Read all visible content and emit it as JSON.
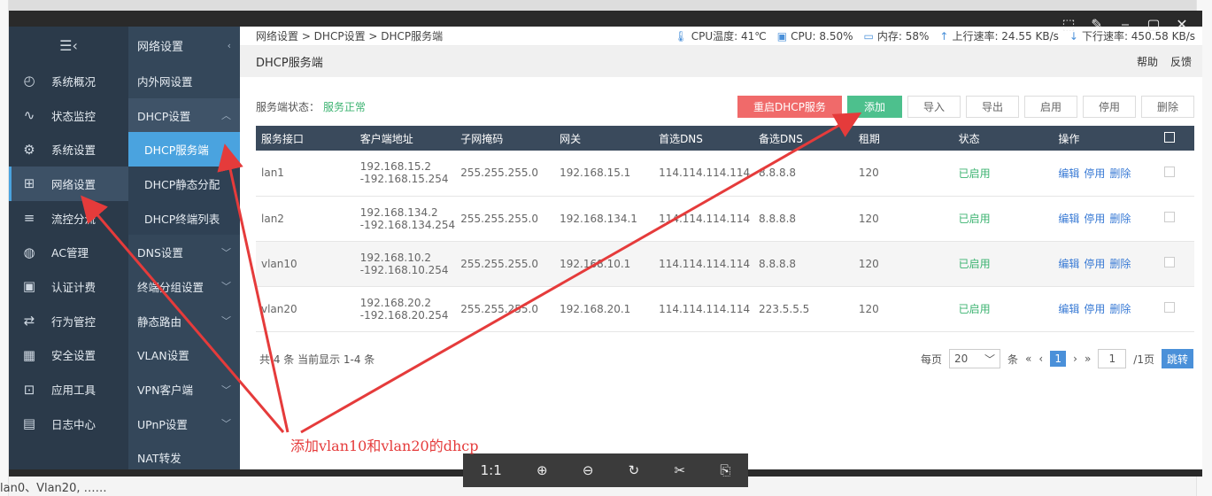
{
  "background": {
    "bottom_text": "lan0、Vlan20, ……"
  },
  "viewer": {
    "buttons": [
      "⬚",
      "✎",
      "⎯",
      "▢",
      "✕"
    ]
  },
  "sidebar": {
    "items": [
      {
        "label": "系统概况",
        "icon": "◴"
      },
      {
        "label": "状态监控",
        "icon": "∿"
      },
      {
        "label": "系统设置",
        "icon": "⚙"
      },
      {
        "label": "网络设置",
        "icon": "⊞"
      },
      {
        "label": "流控分流",
        "icon": "≡"
      },
      {
        "label": "AC管理",
        "icon": "◍"
      },
      {
        "label": "认证计费",
        "icon": "▣"
      },
      {
        "label": "行为管控",
        "icon": "⇄"
      },
      {
        "label": "安全设置",
        "icon": "▦"
      },
      {
        "label": "应用工具",
        "icon": "⊡"
      },
      {
        "label": "日志中心",
        "icon": "▤"
      }
    ]
  },
  "subnav": {
    "title": "网络设置",
    "items": [
      {
        "label": "内外网设置",
        "chev": ""
      },
      {
        "label": "DHCP设置",
        "chev": "︿"
      },
      {
        "label": "DHCP服务端",
        "chev": ""
      },
      {
        "label": "DHCP静态分配",
        "chev": ""
      },
      {
        "label": "DHCP终端列表",
        "chev": ""
      },
      {
        "label": "DNS设置",
        "chev": "﹀"
      },
      {
        "label": "终端分组设置",
        "chev": "﹀"
      },
      {
        "label": "静态路由",
        "chev": "﹀"
      },
      {
        "label": "VLAN设置",
        "chev": ""
      },
      {
        "label": "VPN客户端",
        "chev": "﹀"
      },
      {
        "label": "UPnP设置",
        "chev": "﹀"
      },
      {
        "label": "NAT转发",
        "chev": ""
      }
    ]
  },
  "topbar": {
    "breadcrumb": "网络设置 > DHCP设置 > DHCP服务端",
    "cpu_temp": "CPU温度: 41℃",
    "cpu": "CPU: 8.50%",
    "mem": "内存: 58%",
    "up": "上行速率: 24.55 KB/s",
    "down": "下行速率: 450.58 KB/s"
  },
  "page": {
    "title": "DHCP服务端",
    "help": "帮助",
    "feedback": "反馈"
  },
  "toolbar": {
    "status_label": "服务端状态：",
    "status_value": "服务正常",
    "restart": "重启DHCP服务",
    "add": "添加",
    "import": "导入",
    "export": "导出",
    "enable": "启用",
    "disable": "停用",
    "delete": "删除"
  },
  "table": {
    "headers": [
      "服务接口",
      "客户端地址",
      "子网掩码",
      "网关",
      "首选DNS",
      "备选DNS",
      "租期",
      "状态",
      "操作"
    ],
    "rows": [
      {
        "iface": "lan1",
        "addr1": "192.168.15.2",
        "addr2": "-192.168.15.254",
        "mask": "255.255.255.0",
        "gw": "192.168.15.1",
        "dns1": "114.114.114.114",
        "dns2": "8.8.8.8",
        "lease": "120",
        "status": "已启用"
      },
      {
        "iface": "lan2",
        "addr1": "192.168.134.2",
        "addr2": "-192.168.134.254",
        "mask": "255.255.255.0",
        "gw": "192.168.134.1",
        "dns1": "114.114.114.114",
        "dns2": "8.8.8.8",
        "lease": "120",
        "status": "已启用"
      },
      {
        "iface": "vlan10",
        "addr1": "192.168.10.2",
        "addr2": "-192.168.10.254",
        "mask": "255.255.255.0",
        "gw": "192.168.10.1",
        "dns1": "114.114.114.114",
        "dns2": "8.8.8.8",
        "lease": "120",
        "status": "已启用"
      },
      {
        "iface": "vlan20",
        "addr1": "192.168.20.2",
        "addr2": "-192.168.20.254",
        "mask": "255.255.255.0",
        "gw": "192.168.20.1",
        "dns1": "114.114.114.114",
        "dns2": "223.5.5.5",
        "lease": "120",
        "status": "已启用"
      }
    ],
    "ops": {
      "edit": "编辑",
      "disable": "停用",
      "delete": "删除"
    }
  },
  "footer": {
    "summary": "共 4 条 当前显示 1-4 条",
    "per_page": "每页",
    "per_page_value": "20",
    "unit": "条",
    "current_page": "1",
    "page_input": "1",
    "total_pages": "/1页",
    "go": "跳转"
  },
  "zoombar": {
    "buttons": [
      "1:1",
      "⊕",
      "⊖",
      "↻",
      "✂",
      "⎘"
    ]
  },
  "annotation": {
    "text": "添加vlan10和vlan20的dhcp",
    "color": "#e53b3b"
  }
}
